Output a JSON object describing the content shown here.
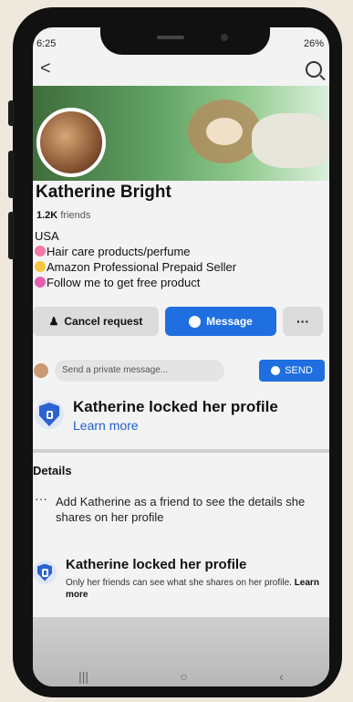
{
  "status_bar": {
    "time": "6:25",
    "battery": "26%"
  },
  "profile": {
    "name": "Katherine Bright",
    "friends_count": "1.2K",
    "friends_label": "friends",
    "bio": [
      "USA",
      "Hair care products/perfume",
      "Amazon Professional Prepaid Seller",
      "Follow me to get free product"
    ]
  },
  "actions": {
    "cancel_label": "Cancel request",
    "message_label": "Message",
    "more_label": "···"
  },
  "private_message": {
    "placeholder": "Send a private message...",
    "send_label": "SEND"
  },
  "locked_banner": {
    "title": "Katherine locked her profile",
    "link": "Learn more"
  },
  "details": {
    "title": "Details",
    "text": "Add Katherine as a friend to see the details she shares on her profile"
  },
  "locked_card": {
    "title": "Katherine locked her profile",
    "desc": "Only her friends can see what she shares on her profile.",
    "link": "Learn more"
  },
  "nav_bar": {
    "recent": "|||",
    "home": "○",
    "back": "‹"
  },
  "colors": {
    "accent": "#1f6fe0",
    "link": "#1f5fd0"
  }
}
